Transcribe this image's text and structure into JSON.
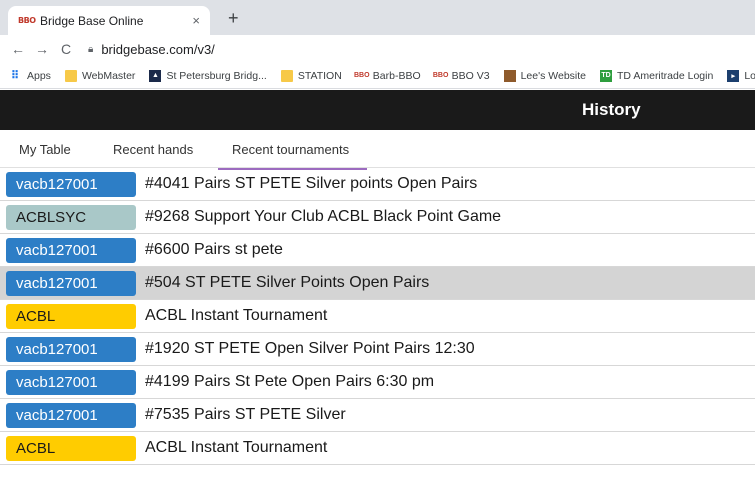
{
  "browser": {
    "tab_title": "Bridge Base Online",
    "tab_close": "×",
    "new_tab": "+",
    "back": "←",
    "forward": "→",
    "reload": "C",
    "url": "bridgebase.com/v3/",
    "bookmarks": [
      {
        "label": "Apps",
        "icon": "apps-grid"
      },
      {
        "label": "WebMaster",
        "icon": "folder"
      },
      {
        "label": "St Petersburg Bridg...",
        "icon": "stpete-favicon"
      },
      {
        "label": "STATION",
        "icon": "folder"
      },
      {
        "label": "Barb-BBO",
        "icon": "bbo-favicon"
      },
      {
        "label": "BBO V3",
        "icon": "bbo-favicon"
      },
      {
        "label": "Lee's Website",
        "icon": "lee-favicon"
      },
      {
        "label": "TD Ameritrade Login",
        "icon": "td-favicon"
      },
      {
        "label": "Log In Ta",
        "icon": "login-favicon"
      }
    ]
  },
  "header": {
    "title": "History"
  },
  "tabs": [
    {
      "label": "My Table"
    },
    {
      "label": "Recent hands"
    },
    {
      "label": "Recent tournaments",
      "active": true
    }
  ],
  "tournaments": [
    {
      "host": "vacb127001",
      "kind": "user",
      "title": "#4041 Pairs ST PETE Silver points Open Pairs"
    },
    {
      "host": "ACBLSYC",
      "kind": "sync",
      "title": "#9268 Support Your Club ACBL Black Point Game"
    },
    {
      "host": "vacb127001",
      "kind": "user",
      "title": "#6600 Pairs st pete"
    },
    {
      "host": "vacb127001",
      "kind": "user",
      "title": "#504 ST PETE Silver Points Open Pairs",
      "selected": true
    },
    {
      "host": "ACBL",
      "kind": "acbl",
      "title": "ACBL Instant Tournament"
    },
    {
      "host": "vacb127001",
      "kind": "user",
      "title": "#1920 ST PETE Open Silver Point Pairs 12:30"
    },
    {
      "host": "vacb127001",
      "kind": "user",
      "title": "#4199 Pairs St Pete Open Pairs 6:30 pm"
    },
    {
      "host": "vacb127001",
      "kind": "user",
      "title": "#7535 Pairs ST PETE Silver"
    },
    {
      "host": "ACBL",
      "kind": "acbl",
      "title": "ACBL Instant Tournament"
    }
  ],
  "colors": {
    "user_badge": "#2d7ec6",
    "sync_badge": "#a9c8c8",
    "acbl_badge": "#ffcc00",
    "header_bg": "#1a1a1a",
    "tab_underline": "#9c6bbf"
  }
}
